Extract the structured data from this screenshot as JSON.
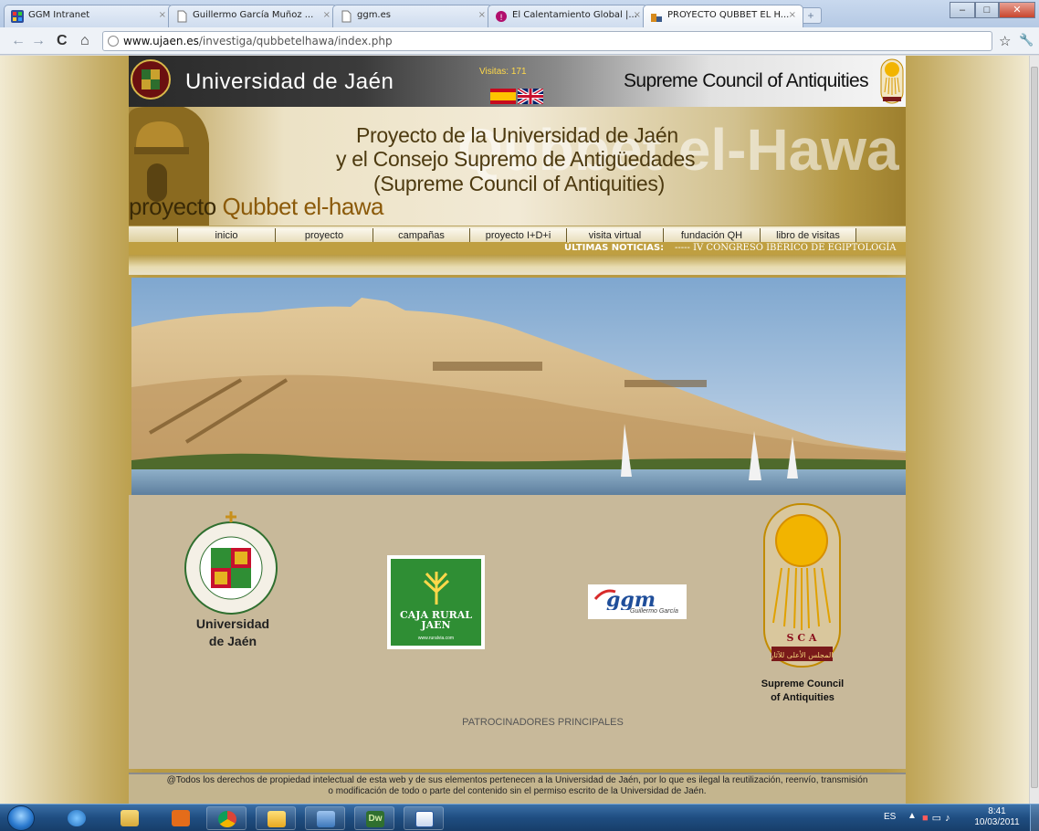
{
  "browser": {
    "tabs": [
      {
        "title": "GGM Intranet",
        "close": "×"
      },
      {
        "title": "Guillermo García Muñoz ...",
        "close": "×"
      },
      {
        "title": "ggm.es",
        "close": "×"
      },
      {
        "title": "El Calentamiento Global |...",
        "close": "×"
      },
      {
        "title": "PROYECTO QUBBET EL H...",
        "close": "×"
      }
    ],
    "new_tab": "+",
    "window_buttons": {
      "minimize": "–",
      "maximize": "□",
      "close": "✕"
    },
    "nav": {
      "back": "←",
      "forward": "→",
      "reload": "C",
      "home": "⌂",
      "star": "☆",
      "wrench": "🔧"
    },
    "url": {
      "host": "www.ujaen.es",
      "path": "/investiga/qubbetelhawa/index.php"
    }
  },
  "header": {
    "university_name": "Universidad de Jaén",
    "visits": "Visitas: 171",
    "sca_name": "Supreme Council of Antiquities"
  },
  "banner": {
    "line1": "Proyecto de la Universidad de Jaén",
    "line2": "y el Consejo Supremo de Antigüedades",
    "line3": "(Supreme Council of Antiquities)",
    "ghost": "Qubbet el-Hawa",
    "logo_prefix": "proyecto ",
    "logo_name": "Qubbet el-hawa"
  },
  "menu": [
    "inicio",
    "proyecto",
    "campañas",
    "proyecto I+D+i",
    "visita virtual",
    "fundación QH",
    "libro de visitas"
  ],
  "news": {
    "label": "ÚLTIMAS NOTICIAS:",
    "text": "----- IV CONGRESO IBÉRICO DE EGIPTOLOGÍA"
  },
  "sponsors": {
    "uja_caption_1": "Universidad",
    "uja_caption_2": "de Jaén",
    "uja_ring_text": "VNIVERSITAS GIENNENSIS",
    "caja_name_1": "CAJA RURAL",
    "caja_name_2": "JAEN",
    "caja_url": "www.ruralvia.com",
    "ggm_mark": "ggm",
    "ggm_sub": "Guillermo García",
    "sca_letters": "S   C   A",
    "sca_arabic": "المجلس الأعلى للآثار",
    "sca_caption_1": "Supreme Council",
    "sca_caption_2": "of Antiquities",
    "title": "PATROCINADORES PRINCIPALES"
  },
  "footer": {
    "line1": "@Todos los derechos de propiedad intelectual de esta web y de sus elementos pertenecen a la Universidad de Jaén, por lo que es ilegal la reutilización, reenvío, transmisión",
    "line2": "o modificación de todo o parte del contenido sin el permiso escrito de la Universidad de Jaén."
  },
  "taskbar": {
    "lang": "ES",
    "tray_arrow": "▲",
    "time": "8:41",
    "date": "10/03/2011",
    "dw_label": "Dw"
  },
  "colors": {
    "page_gold": "#b89a43",
    "sponsor_bg": "#c8b99a",
    "news_bar": "#bf9f41",
    "caja_green": "#2f8e34",
    "sca_gold": "#f2b400"
  }
}
